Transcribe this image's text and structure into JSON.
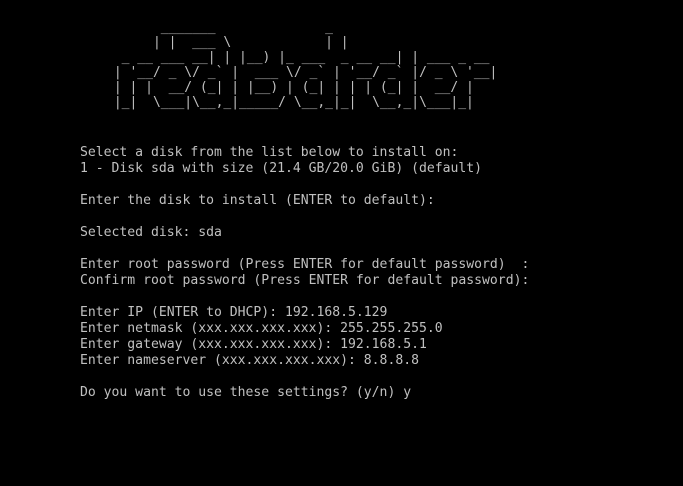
{
  "colors": {
    "background": "#000000",
    "foreground": "#c0c0c0"
  },
  "banner": {
    "ascii_art": "       _______              _\n      | |  ___ \\            | |\n  _ __ ___ __| | |__) |_ ___  _ __ __| | ___ _ __\n | '__/ _ \\/ _` |  ___ \\/ _` | '__/ _` |/ _ \\ '__|\n | | |  __/ (_| | |__) | (_| | | | (_| |  __/ |\n |_|  \\___|\\__,_|_____/ \\__,_|_|  \\__,_|\\___|_|"
  },
  "installer": {
    "disk_prompt": "Select a disk from the list below to install on:",
    "disk_option_1": "1 - Disk sda with size (21.4 GB/20.0 GiB) (default)",
    "disk_enter_prompt": "Enter the disk to install (ENTER to default):",
    "selected_disk": "Selected disk: sda",
    "root_password_prompt": "Enter root password (Press ENTER for default password)  :",
    "root_password_confirm": "Confirm root password (Press ENTER for default password):",
    "ip_line": "Enter IP (ENTER to DHCP): 192.168.5.129",
    "netmask_line": "Enter netmask (xxx.xxx.xxx.xxx): 255.255.255.0",
    "gateway_line": "Enter gateway (xxx.xxx.xxx.xxx): 192.168.5.1",
    "nameserver_line": "Enter nameserver (xxx.xxx.xxx.xxx): 8.8.8.8",
    "confirm_settings_prompt": "Do you want to use these settings? (y/n)",
    "confirm_settings_answer": "y"
  }
}
